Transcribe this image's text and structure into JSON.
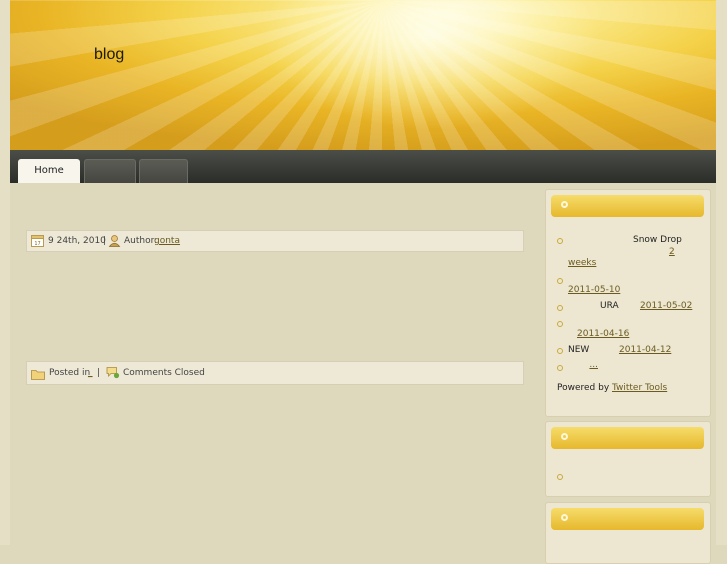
{
  "header": {
    "blog_title": "blog"
  },
  "nav": {
    "tabs": [
      {
        "label": "Home"
      },
      {
        "label": ""
      },
      {
        "label": ""
      }
    ]
  },
  "post_meta": {
    "date": "9  24th, 2010",
    "separator": "|",
    "author_label": "Author:",
    "author_name": "gonta"
  },
  "post_footer": {
    "posted_in_label": "Posted in",
    "category": "_",
    "separator": "|",
    "comments": "Comments Closed"
  },
  "sidebar": {
    "twitter_widget": {
      "items": [
        {
          "text": "Snow Drop",
          "link_a": "2",
          "link_b": "weeks"
        },
        {
          "date": "2011-05-10"
        },
        {
          "text": "URA",
          "date": "2011-05-02"
        },
        {
          "date": "2011-04-16"
        },
        {
          "text": "NEW",
          "date": "2011-04-12"
        },
        {
          "link": "..."
        }
      ],
      "powered_by_label": "Powered by",
      "powered_by_link": "Twitter Tools"
    },
    "second_widget": {
      "items": [
        {
          "link": ""
        }
      ]
    }
  }
}
